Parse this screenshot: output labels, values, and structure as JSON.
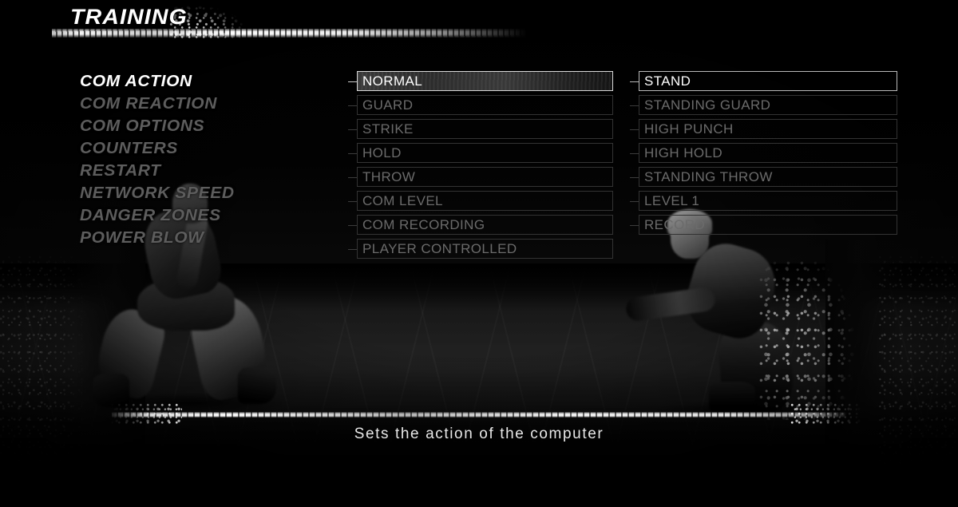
{
  "header": {
    "title": "TRAINING"
  },
  "sidebar": {
    "items": [
      {
        "label": "COM ACTION",
        "active": true
      },
      {
        "label": "COM REACTION",
        "active": false
      },
      {
        "label": "COM OPTIONS",
        "active": false
      },
      {
        "label": "COUNTERS",
        "active": false
      },
      {
        "label": "RESTART",
        "active": false
      },
      {
        "label": "NETWORK SPEED",
        "active": false
      },
      {
        "label": "DANGER ZONES",
        "active": false
      },
      {
        "label": "POWER BLOW",
        "active": false
      }
    ]
  },
  "middle_column": {
    "items": [
      {
        "label": "NORMAL",
        "selected": true
      },
      {
        "label": "GUARD",
        "selected": false
      },
      {
        "label": "STRIKE",
        "selected": false
      },
      {
        "label": "HOLD",
        "selected": false
      },
      {
        "label": "THROW",
        "selected": false
      },
      {
        "label": "COM LEVEL",
        "selected": false
      },
      {
        "label": "COM RECORDING",
        "selected": false
      },
      {
        "label": "PLAYER CONTROLLED",
        "selected": false
      }
    ]
  },
  "right_column": {
    "items": [
      {
        "label": "STAND",
        "active": true
      },
      {
        "label": "STANDING GUARD",
        "active": false
      },
      {
        "label": "HIGH PUNCH",
        "active": false
      },
      {
        "label": "HIGH HOLD",
        "active": false
      },
      {
        "label": "STANDING THROW",
        "active": false
      },
      {
        "label": "LEVEL 1",
        "active": false
      },
      {
        "label": "RECORD",
        "active": false
      }
    ]
  },
  "footer": {
    "description": "Sets the action of the computer"
  },
  "colors": {
    "background": "#000000",
    "text_active": "#ffffff",
    "text_inactive": "#6b6b6b",
    "sidebar_inactive": "#5d5d5d",
    "box_border": "#333333",
    "box_border_active": "#b9b9b9",
    "accent_stroke": "#ffffff"
  }
}
